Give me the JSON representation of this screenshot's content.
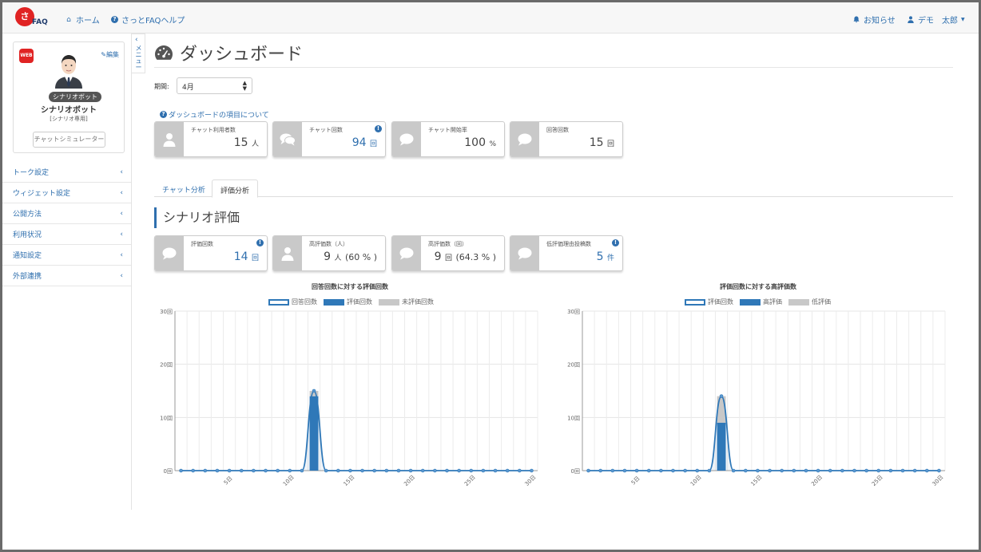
{
  "navbar": {
    "logo_mark": "さっと",
    "logo_text": "FAQ",
    "home": "ホーム",
    "help": "さっとFAQヘルプ",
    "notice": "お知らせ",
    "user": "デモ　太郎"
  },
  "profile": {
    "web_badge": "WEB",
    "edit": "編集",
    "badge": "シナリオボット",
    "name": "シナリオボット",
    "sub": "[シナリオ専用]",
    "simulator": "チャットシミュレーター"
  },
  "menu_toggle": "メニュー",
  "menu": [
    {
      "label": "トーク設定"
    },
    {
      "label": "ウィジェット設定"
    },
    {
      "label": "公開方法"
    },
    {
      "label": "利用状況"
    },
    {
      "label": "通知設定"
    },
    {
      "label": "外部連携"
    }
  ],
  "page": {
    "title": "ダッシュボード",
    "period_label": "期間:",
    "period_value": "4月",
    "help_link": "ダッシュボードの項目について"
  },
  "summary": [
    {
      "label": "チャット利用者数",
      "value": "15",
      "unit": "人",
      "accent": false,
      "info": false
    },
    {
      "label": "チャット回数",
      "value": "94",
      "unit": "回",
      "accent": true,
      "info": true
    },
    {
      "label": "チャット開始率",
      "value": "100",
      "unit": "%",
      "accent": false,
      "info": false
    },
    {
      "label": "回答回数",
      "value": "15",
      "unit": "回",
      "accent": false,
      "info": false
    }
  ],
  "tabs": {
    "chat": "チャット分析",
    "eval": "評価分析"
  },
  "section": {
    "title": "シナリオ評価"
  },
  "eval_summary": [
    {
      "label": "評価回数",
      "value": "14",
      "unit": "回",
      "extra": "",
      "accent": true,
      "info": true
    },
    {
      "label": "高評価数（人）",
      "value": "9",
      "unit": "人",
      "extra": "(60 % )",
      "accent": false,
      "info": false
    },
    {
      "label": "高評価数（回）",
      "value": "9",
      "unit": "回",
      "extra": "(64.3 % )",
      "accent": false,
      "info": false
    },
    {
      "label": "低評価理由投稿数",
      "value": "5",
      "unit": "件",
      "extra": "",
      "accent": true,
      "info": true
    }
  ],
  "colors": {
    "accent": "#2f6fae",
    "bar_dark": "#2f78b8",
    "bar_light": "#c8c8c8"
  },
  "chart_data": [
    {
      "type": "bar",
      "title": "回答回数に対する評価回数",
      "legend": [
        "回答回数",
        "評価回数",
        "未評価回数"
      ],
      "x": [
        1,
        2,
        3,
        4,
        5,
        6,
        7,
        8,
        9,
        10,
        11,
        12,
        13,
        14,
        15,
        16,
        17,
        18,
        19,
        20,
        21,
        22,
        23,
        24,
        25,
        26,
        27,
        28,
        29,
        30
      ],
      "x_tick_labels": [
        "5日",
        "10日",
        "15日",
        "20日",
        "25日",
        "30日"
      ],
      "y_tick_labels": [
        "0回",
        "10回",
        "20回",
        "30回"
      ],
      "ylim": [
        0,
        30
      ],
      "series": [
        {
          "name": "回答回数",
          "kind": "line",
          "values": [
            0,
            0,
            0,
            0,
            0,
            0,
            0,
            0,
            0,
            0,
            0,
            15,
            0,
            0,
            0,
            0,
            0,
            0,
            0,
            0,
            0,
            0,
            0,
            0,
            0,
            0,
            0,
            0,
            0,
            0
          ]
        },
        {
          "name": "評価回数",
          "kind": "bar",
          "values": [
            0,
            0,
            0,
            0,
            0,
            0,
            0,
            0,
            0,
            0,
            0,
            14,
            0,
            0,
            0,
            0,
            0,
            0,
            0,
            0,
            0,
            0,
            0,
            0,
            0,
            0,
            0,
            0,
            0,
            0
          ]
        },
        {
          "name": "未評価回数",
          "kind": "bar",
          "values": [
            0,
            0,
            0,
            0,
            0,
            0,
            0,
            0,
            0,
            0,
            0,
            1,
            0,
            0,
            0,
            0,
            0,
            0,
            0,
            0,
            0,
            0,
            0,
            0,
            0,
            0,
            0,
            0,
            0,
            0
          ]
        }
      ]
    },
    {
      "type": "bar",
      "title": "評価回数に対する高評価数",
      "legend": [
        "評価回数",
        "高評価",
        "低評価"
      ],
      "x": [
        1,
        2,
        3,
        4,
        5,
        6,
        7,
        8,
        9,
        10,
        11,
        12,
        13,
        14,
        15,
        16,
        17,
        18,
        19,
        20,
        21,
        22,
        23,
        24,
        25,
        26,
        27,
        28,
        29,
        30
      ],
      "x_tick_labels": [
        "5日",
        "10日",
        "15日",
        "20日",
        "25日",
        "30日"
      ],
      "y_tick_labels": [
        "0回",
        "10回",
        "20回",
        "30回"
      ],
      "ylim": [
        0,
        30
      ],
      "series": [
        {
          "name": "評価回数",
          "kind": "line",
          "values": [
            0,
            0,
            0,
            0,
            0,
            0,
            0,
            0,
            0,
            0,
            0,
            14,
            0,
            0,
            0,
            0,
            0,
            0,
            0,
            0,
            0,
            0,
            0,
            0,
            0,
            0,
            0,
            0,
            0,
            0
          ]
        },
        {
          "name": "高評価",
          "kind": "bar",
          "values": [
            0,
            0,
            0,
            0,
            0,
            0,
            0,
            0,
            0,
            0,
            0,
            9,
            0,
            0,
            0,
            0,
            0,
            0,
            0,
            0,
            0,
            0,
            0,
            0,
            0,
            0,
            0,
            0,
            0,
            0
          ]
        },
        {
          "name": "低評価",
          "kind": "bar",
          "values": [
            0,
            0,
            0,
            0,
            0,
            0,
            0,
            0,
            0,
            0,
            0,
            5,
            0,
            0,
            0,
            0,
            0,
            0,
            0,
            0,
            0,
            0,
            0,
            0,
            0,
            0,
            0,
            0,
            0,
            0
          ]
        }
      ]
    }
  ]
}
